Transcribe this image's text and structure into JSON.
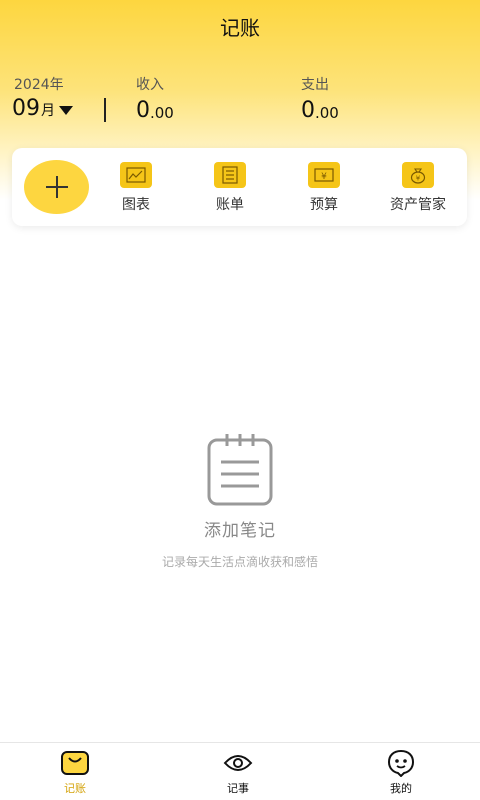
{
  "header": {
    "title": "记账"
  },
  "summary": {
    "year": "2024年",
    "month": "09",
    "month_unit": "月",
    "income_label": "收入",
    "income_int": "0",
    "income_dec": ".00",
    "expense_label": "支出",
    "expense_int": "0",
    "expense_dec": ".00"
  },
  "toolbar": {
    "items": [
      {
        "label": "图表",
        "icon": "chart-icon"
      },
      {
        "label": "账单",
        "icon": "bill-icon"
      },
      {
        "label": "预算",
        "icon": "budget-icon"
      },
      {
        "label": "资产管家",
        "icon": "money-bag-icon"
      }
    ]
  },
  "empty_state": {
    "title": "添加笔记",
    "subtitle": "记录每天生活点滴收获和感悟"
  },
  "tabbar": {
    "items": [
      {
        "label": "记账",
        "icon": "bag-icon",
        "active": true
      },
      {
        "label": "记事",
        "icon": "eye-icon",
        "active": false
      },
      {
        "label": "我的",
        "icon": "face-icon",
        "active": false
      }
    ]
  },
  "colors": {
    "accent": "#fdd640",
    "accent_dark": "#d4a30a",
    "icon_yellow": "#f5c518"
  }
}
